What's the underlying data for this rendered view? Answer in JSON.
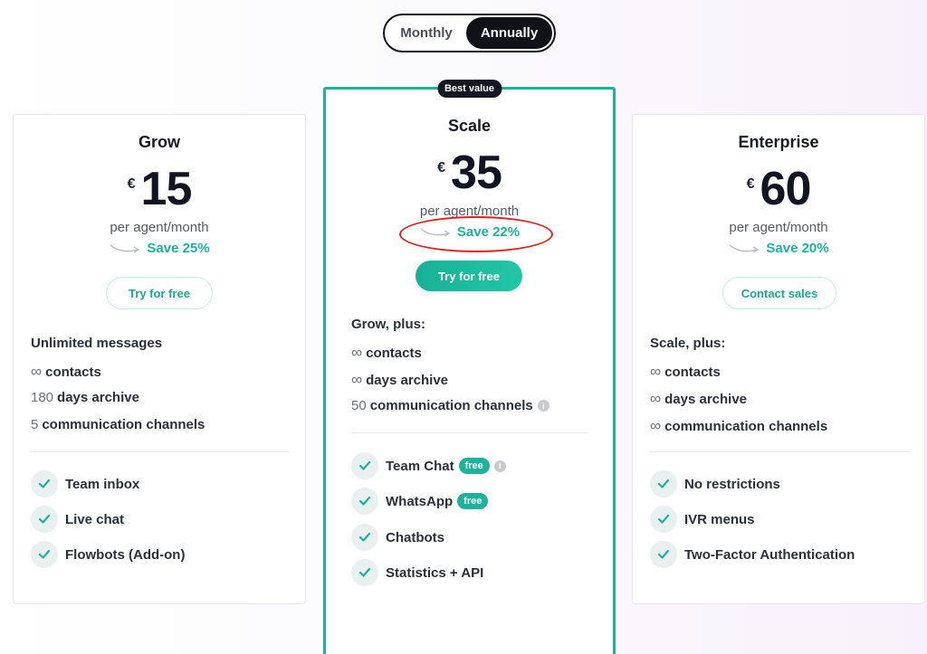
{
  "billing_toggle": {
    "monthly": "Monthly",
    "annually": "Annually",
    "selected": "Annually"
  },
  "plans": [
    {
      "name": "Grow",
      "currency": "€",
      "price": "15",
      "per": "per agent/month",
      "save": "Save 25%",
      "cta": "Try for free",
      "includes": [
        {
          "prefix": "",
          "text": "Unlimited messages"
        },
        {
          "prefix": "∞",
          "text": "contacts"
        },
        {
          "prefix": "180",
          "text": "days archive"
        },
        {
          "prefix": "5",
          "text": "communication channels"
        }
      ],
      "features": [
        "Team inbox",
        "Live chat",
        "Flowbots (Add-on)"
      ]
    },
    {
      "name": "Scale",
      "badge": "Best value",
      "currency": "€",
      "price": "35",
      "per": "per agent/month",
      "save": "Save 22%",
      "cta": "Try for free",
      "heading": "Grow, plus:",
      "includes": [
        {
          "prefix": "∞",
          "text": "contacts"
        },
        {
          "prefix": "∞",
          "text": "days archive"
        },
        {
          "prefix": "50",
          "text": "communication channels"
        }
      ],
      "features": [
        {
          "label": "Team Chat",
          "pill": "free"
        },
        {
          "label": "WhatsApp",
          "pill": "free"
        },
        {
          "label": "Chatbots"
        },
        {
          "label": "Statistics + API"
        }
      ]
    },
    {
      "name": "Enterprise",
      "currency": "€",
      "price": "60",
      "per": "per agent/month",
      "save": "Save 20%",
      "cta": "Contact sales",
      "heading": "Scale, plus:",
      "includes": [
        {
          "prefix": "∞",
          "text": "contacts"
        },
        {
          "prefix": "∞",
          "text": "days archive"
        },
        {
          "prefix": "∞",
          "text": "communication channels"
        }
      ],
      "features": [
        "No restrictions",
        "IVR menus",
        "Two-Factor Authentication"
      ]
    }
  ],
  "colors": {
    "accent": "#1cb39a",
    "annotation": "#e02020",
    "dark": "#101217"
  }
}
